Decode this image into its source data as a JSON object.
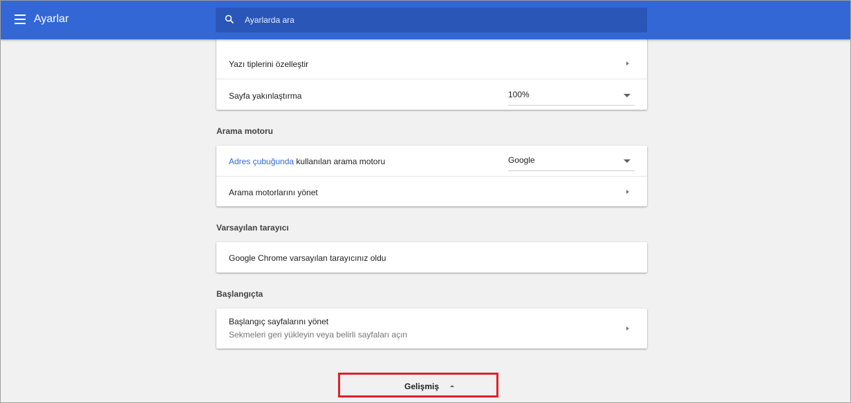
{
  "header": {
    "title": "Ayarlar",
    "search_placeholder": "Ayarlarda ara"
  },
  "appearance": {
    "fonts_label": "Yazı tiplerini özelleştir",
    "zoom_label": "Sayfa yakınlaştırma",
    "zoom_value": "100%"
  },
  "search_engine": {
    "section_title": "Arama motoru",
    "address_bar_link": "Adres çubuğunda",
    "address_bar_text": " kullanılan arama motoru",
    "engine_value": "Google",
    "manage_label": "Arama motorlarını yönet"
  },
  "default_browser": {
    "section_title": "Varsayılan tarayıcı",
    "status_text": "Google Chrome varsayılan tarayıcınız oldu"
  },
  "on_startup": {
    "section_title": "Başlangıçta",
    "manage_label": "Başlangıç sayfalarını yönet",
    "manage_description": "Sekmeleri geri yükleyin veya belirli sayfaları açın"
  },
  "advanced": {
    "label": "Gelişmiş"
  },
  "colors": {
    "header_bg": "#3367d6",
    "search_bg": "#2a56b8",
    "highlight_border": "#e0202a",
    "link": "#3367d6"
  }
}
